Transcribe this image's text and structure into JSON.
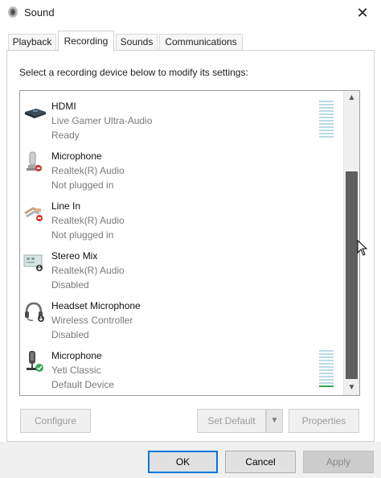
{
  "window": {
    "title": "Sound",
    "close_label": "✕"
  },
  "tabs": [
    {
      "label": "Playback"
    },
    {
      "label": "Recording"
    },
    {
      "label": "Sounds"
    },
    {
      "label": "Communications"
    }
  ],
  "instruction": "Select a recording device below to modify its settings:",
  "devices": [
    {
      "name": "HDMI",
      "subtitle": "Live Gamer Ultra-Audio",
      "status": "Ready",
      "icon": "hdmi-capture-icon"
    },
    {
      "name": "Microphone",
      "subtitle": "Realtek(R) Audio",
      "status": "Not plugged in",
      "icon": "microphone-icon"
    },
    {
      "name": "Line In",
      "subtitle": "Realtek(R) Audio",
      "status": "Not plugged in",
      "icon": "line-in-icon"
    },
    {
      "name": "Stereo Mix",
      "subtitle": "Realtek(R) Audio",
      "status": "Disabled",
      "icon": "stereo-mix-icon"
    },
    {
      "name": "Headset Microphone",
      "subtitle": "Wireless Controller",
      "status": "Disabled",
      "icon": "headset-icon"
    },
    {
      "name": "Microphone",
      "subtitle": "Yeti Classic",
      "status": "Default Device",
      "icon": "usb-microphone-icon"
    }
  ],
  "buttons": {
    "configure": "Configure",
    "set_default": "Set Default",
    "set_default_arrow": "▼",
    "properties": "Properties"
  },
  "footer": {
    "ok": "OK",
    "cancel": "Cancel",
    "apply": "Apply"
  },
  "scrollbar": {
    "up": "▲",
    "down": "▼"
  },
  "colors": {
    "accent": "#0078d7",
    "level_meter": "#b9dbe7",
    "default_check": "#2fa84f",
    "unplugged_badge": "#d9342b"
  }
}
